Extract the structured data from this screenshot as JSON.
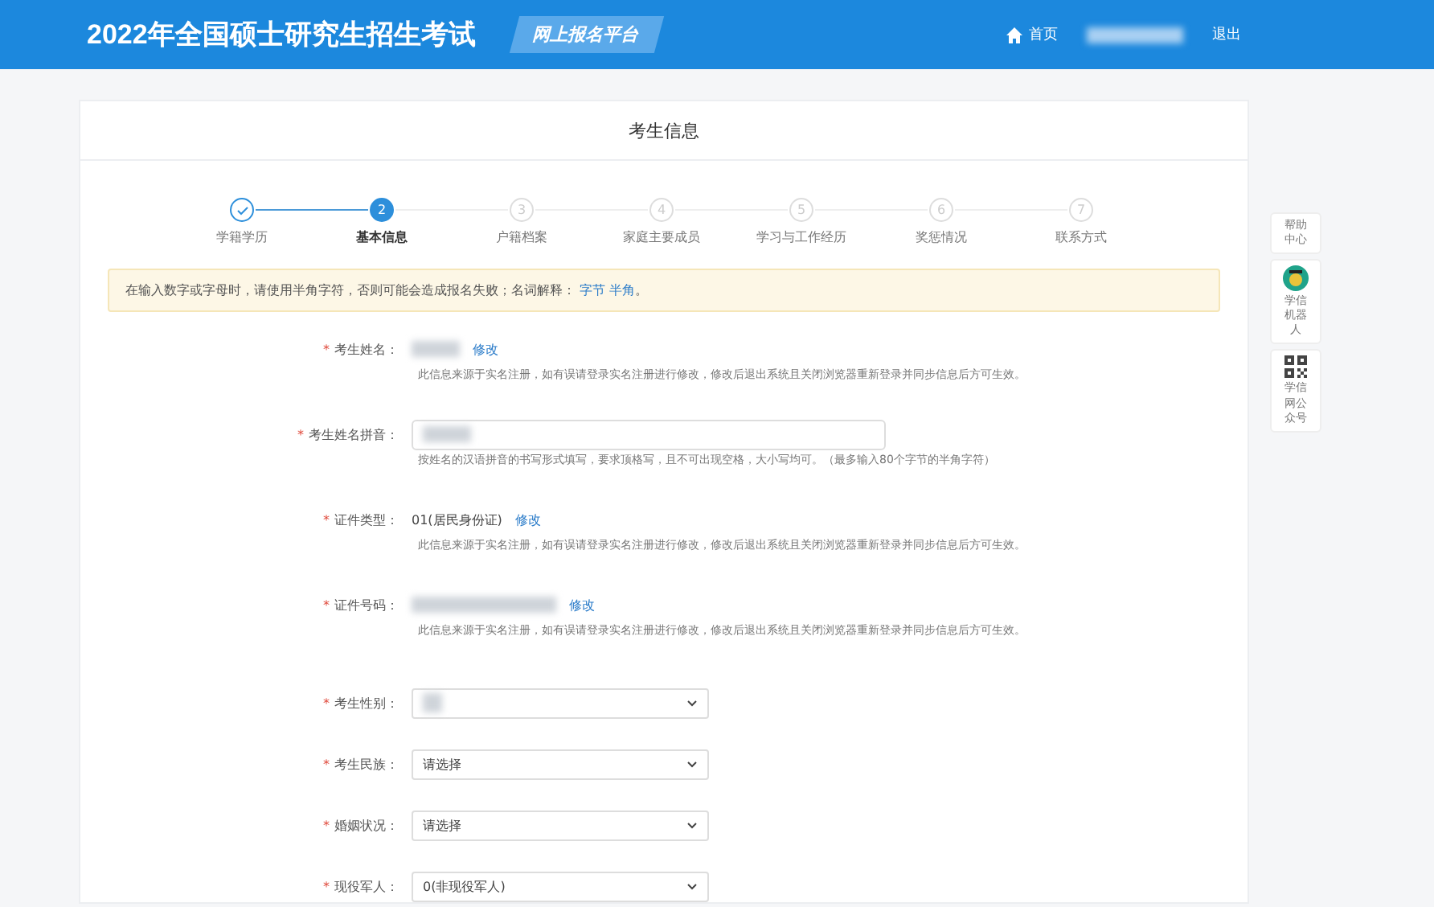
{
  "header": {
    "title": "2022年全国硕士研究生招生考试",
    "badge": "网上报名平台",
    "nav": [
      {
        "kind": "link",
        "label": "首页",
        "icon": true
      },
      {
        "kind": "redacted"
      },
      {
        "kind": "link",
        "label": "退出",
        "icon": false
      }
    ]
  },
  "card": {
    "title": "考生信息",
    "steps": [
      {
        "label": "学籍学历",
        "completed": true,
        "selected": false
      },
      {
        "number": "2",
        "label": "基本信息",
        "completed": false,
        "selected": true
      },
      {
        "number": "3",
        "label": "户籍档案",
        "completed": false,
        "selected": false
      },
      {
        "number": "4",
        "label": "家庭主要成员",
        "completed": false,
        "selected": false
      },
      {
        "number": "5",
        "label": "学习与工作经历",
        "completed": false,
        "selected": false
      },
      {
        "number": "6",
        "label": "奖惩情况",
        "completed": false,
        "selected": false
      },
      {
        "number": "7",
        "label": "联系方式",
        "completed": false,
        "selected": false
      }
    ],
    "notice": {
      "text": "在输入数字或字母时，请使用半角字符，否则可能会造成报名失败；名词解释：",
      "links": [
        "字节",
        "半角"
      ],
      "end": "。"
    },
    "fields": [
      {
        "kind": "text",
        "mark": "*",
        "label": "考生姓名：",
        "redacted": true,
        "link": "修改",
        "hint": "此信息来源于实名注册，如有误请登录实名注册进行修改，修改后退出系统且关闭浏览器重新登录并同步信息后方可生效。"
      },
      {
        "kind": "input",
        "mark": "*",
        "label": "考生姓名拼音：",
        "redacted": true,
        "hint": "按姓名的汉语拼音的书写形式填写，要求顶格写，且不可出现空格，大小写均可。（最多输入80个字节的半角字符）"
      },
      {
        "kind": "text",
        "mark": "*",
        "label": "证件类型：",
        "redacted": false,
        "value": "01(居民身份证)",
        "link": "修改",
        "hint": "此信息来源于实名注册，如有误请登录实名注册进行修改，修改后退出系统且关闭浏览器重新登录并同步信息后方可生效。"
      },
      {
        "kind": "text",
        "mark": "*",
        "label": "证件号码：",
        "redacted": true,
        "link": "修改",
        "hint": "此信息来源于实名注册，如有误请登录实名注册进行修改，修改后退出系统且关闭浏览器重新登录并同步信息后方可生效。"
      },
      {
        "kind": "select",
        "mark": "*",
        "label": "考生性别：",
        "redacted": true
      },
      {
        "kind": "select",
        "mark": "*",
        "label": "考生民族：",
        "redacted": false,
        "value": "请选择"
      },
      {
        "kind": "select",
        "mark": "*",
        "label": "婚姻状况：",
        "redacted": false,
        "value": "请选择"
      },
      {
        "kind": "select",
        "mark": "*",
        "label": "现役军人：",
        "redacted": false,
        "value": "0(非现役军人)"
      }
    ]
  },
  "side_tools": [
    {
      "kind": "text",
      "label": "帮助中心"
    },
    {
      "kind": "robot",
      "label": "学信机器人"
    },
    {
      "kind": "qr",
      "label": "学信网公众号"
    }
  ]
}
